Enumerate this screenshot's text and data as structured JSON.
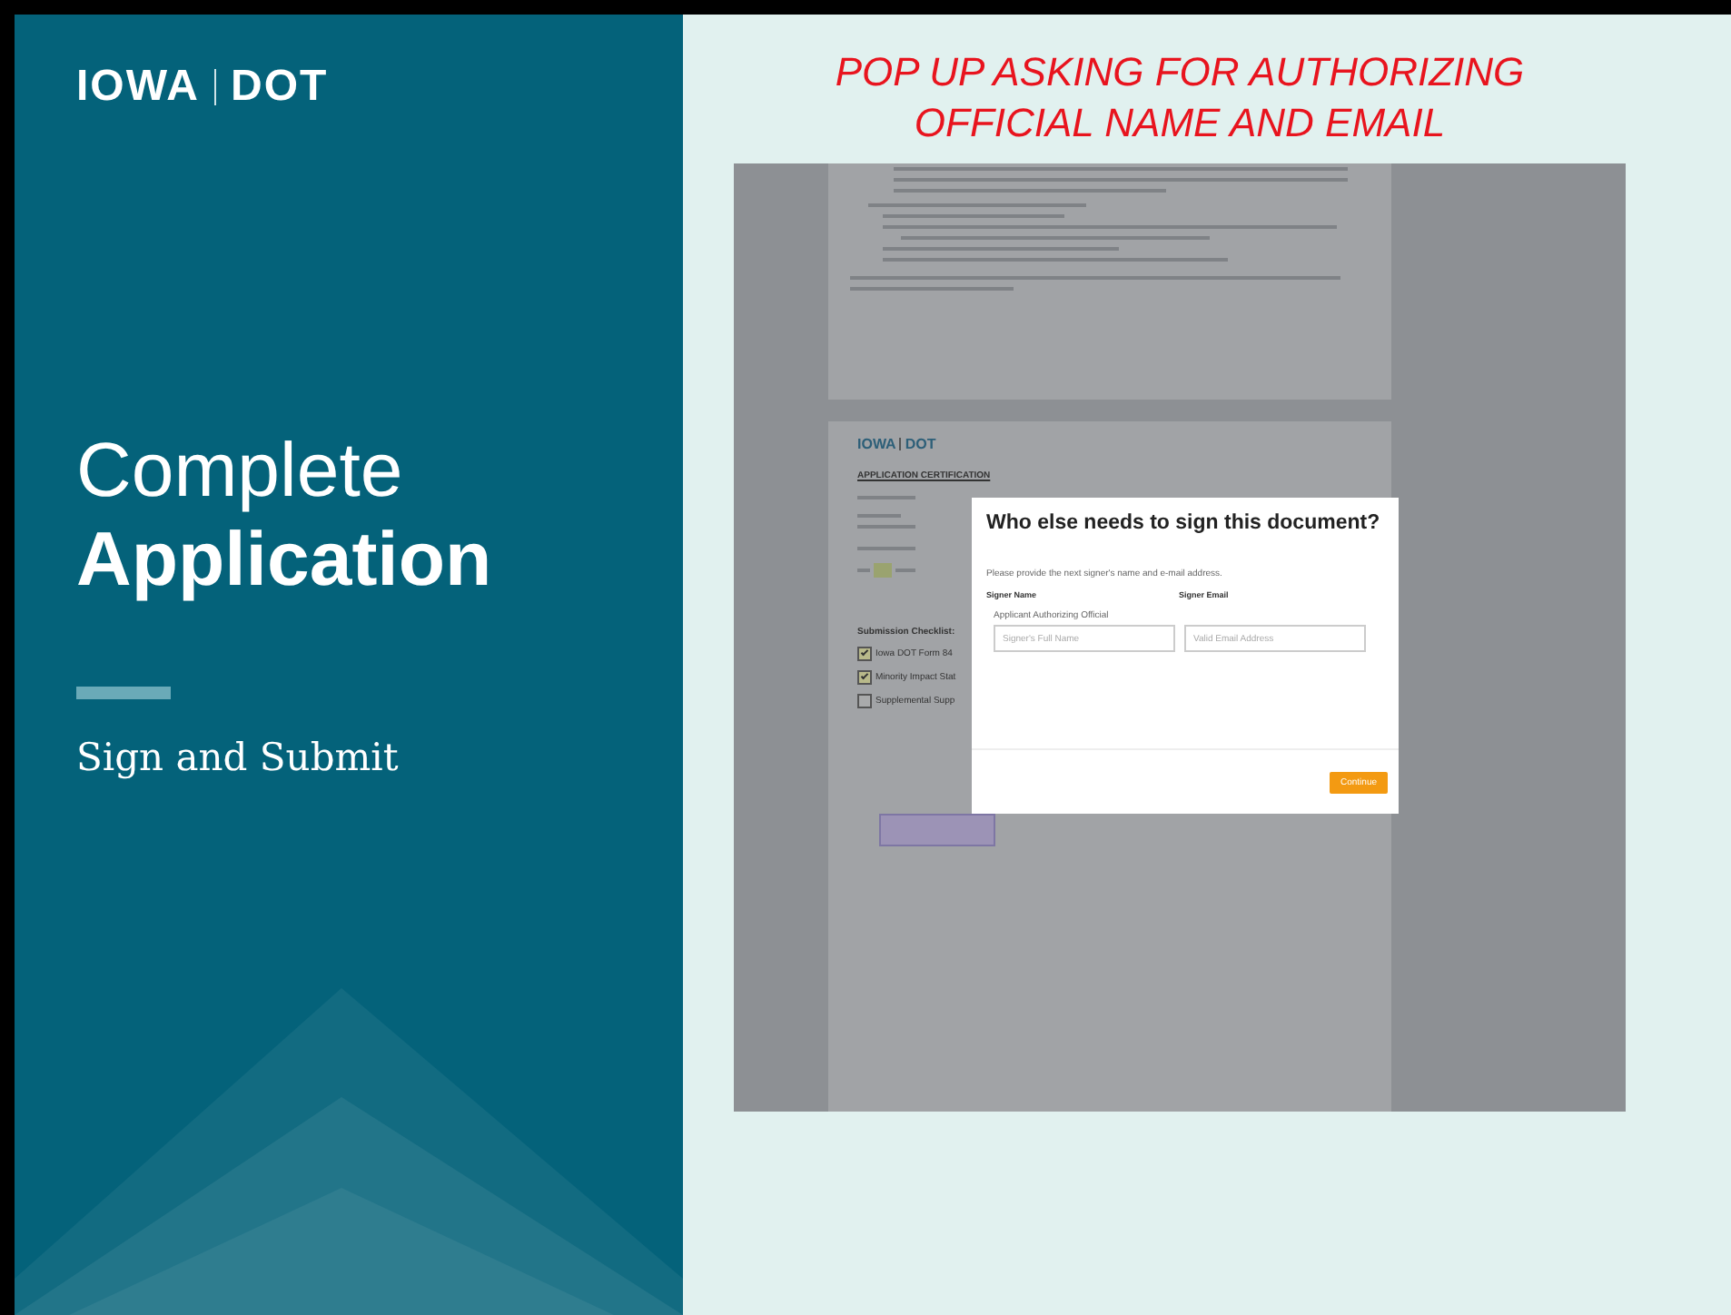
{
  "slide": {
    "logo": {
      "left": "IOWA",
      "right": "DOT"
    },
    "title_light": "Complete",
    "title_bold": "Application",
    "subtitle": "Sign and Submit"
  },
  "caption": {
    "lines": [
      "POP UP ASKING FOR AUTHORIZING",
      "OFFICIAL NAME AND EMAIL"
    ]
  },
  "document": {
    "logo": {
      "left": "IOWA",
      "right": "DOT"
    },
    "heading": "APPLICATION CERTIFICATION",
    "checklist_title": "Submission Checklist:",
    "checklist": [
      {
        "label": "Iowa DOT Form 84",
        "checked": true
      },
      {
        "label": "Minority Impact Stat",
        "checked": true
      },
      {
        "label": "Supplemental Supp",
        "checked": false
      }
    ]
  },
  "modal": {
    "title": "Who else needs to sign this document?",
    "instruction": "Please provide the next signer's name and e-mail address.",
    "columns": [
      "Signer Name",
      "Signer Email"
    ],
    "role": "Applicant Authorizing Official",
    "fields": [
      {
        "placeholder": "Signer's Full Name"
      },
      {
        "placeholder": "Valid Email Address"
      }
    ],
    "button": "Continue"
  }
}
